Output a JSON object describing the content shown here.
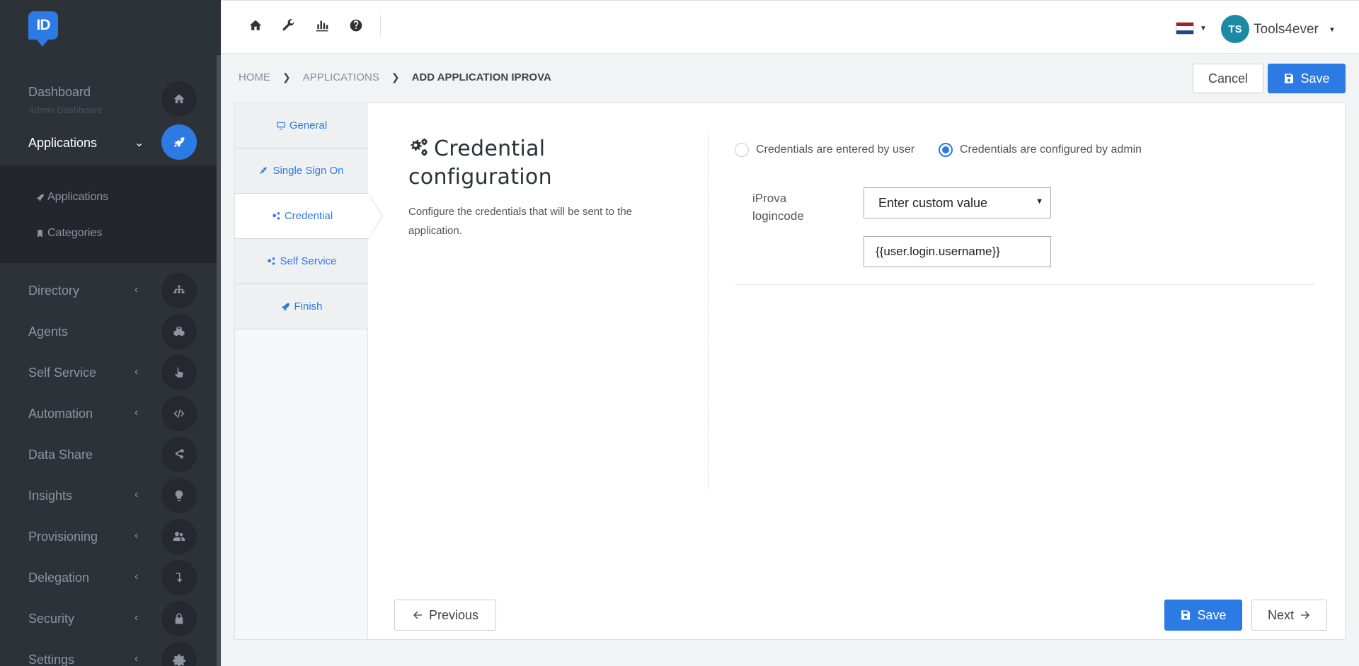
{
  "app": {
    "logo_text": "ID"
  },
  "sidebar": {
    "dashboard": {
      "label": "Dashboard",
      "sub": "Admin Dashboard"
    },
    "applications": {
      "label": "Applications"
    },
    "submenu": [
      {
        "label": "Applications"
      },
      {
        "label": "Categories"
      }
    ],
    "items": [
      {
        "label": "Directory"
      },
      {
        "label": "Agents"
      },
      {
        "label": "Self Service"
      },
      {
        "label": "Automation"
      },
      {
        "label": "Data Share"
      },
      {
        "label": "Insights"
      },
      {
        "label": "Provisioning"
      },
      {
        "label": "Delegation"
      },
      {
        "label": "Security"
      },
      {
        "label": "Settings"
      }
    ]
  },
  "topbar": {
    "icons": [
      "home-icon",
      "wrench-icon",
      "bar-chart-icon",
      "help-icon"
    ],
    "user": {
      "initials": "TS",
      "name": "Tools4ever"
    },
    "flag_colors": [
      "#ae1c28",
      "#ffffff",
      "#21468b"
    ]
  },
  "breadcrumb": {
    "home": "HOME",
    "applications": "APPLICATIONS",
    "current": "ADD APPLICATION IPROVA"
  },
  "actions": {
    "cancel": "Cancel",
    "save": "Save"
  },
  "wizard": {
    "steps": [
      {
        "label": "General"
      },
      {
        "label": "Single Sign On"
      },
      {
        "label": "Credential"
      },
      {
        "label": "Self Service"
      },
      {
        "label": "Finish"
      }
    ],
    "panel": {
      "title_line1": "Credential",
      "title_line2": "configuration",
      "description": "Configure the credentials that will be sent to the application."
    },
    "radio_options": [
      {
        "label": "Credentials are entered by user",
        "checked": false
      },
      {
        "label": "Credentials are configured by admin",
        "checked": true
      }
    ],
    "field": {
      "label_line1": "iProva",
      "label_line2": "logincode",
      "select_value": "Enter custom value",
      "input_value": "{{user.login.username}}"
    },
    "footer": {
      "previous": "Previous",
      "save": "Save",
      "next": "Next"
    }
  },
  "colors": {
    "primary": "#2c7be5",
    "sidebar_bg": "#2d3138"
  }
}
